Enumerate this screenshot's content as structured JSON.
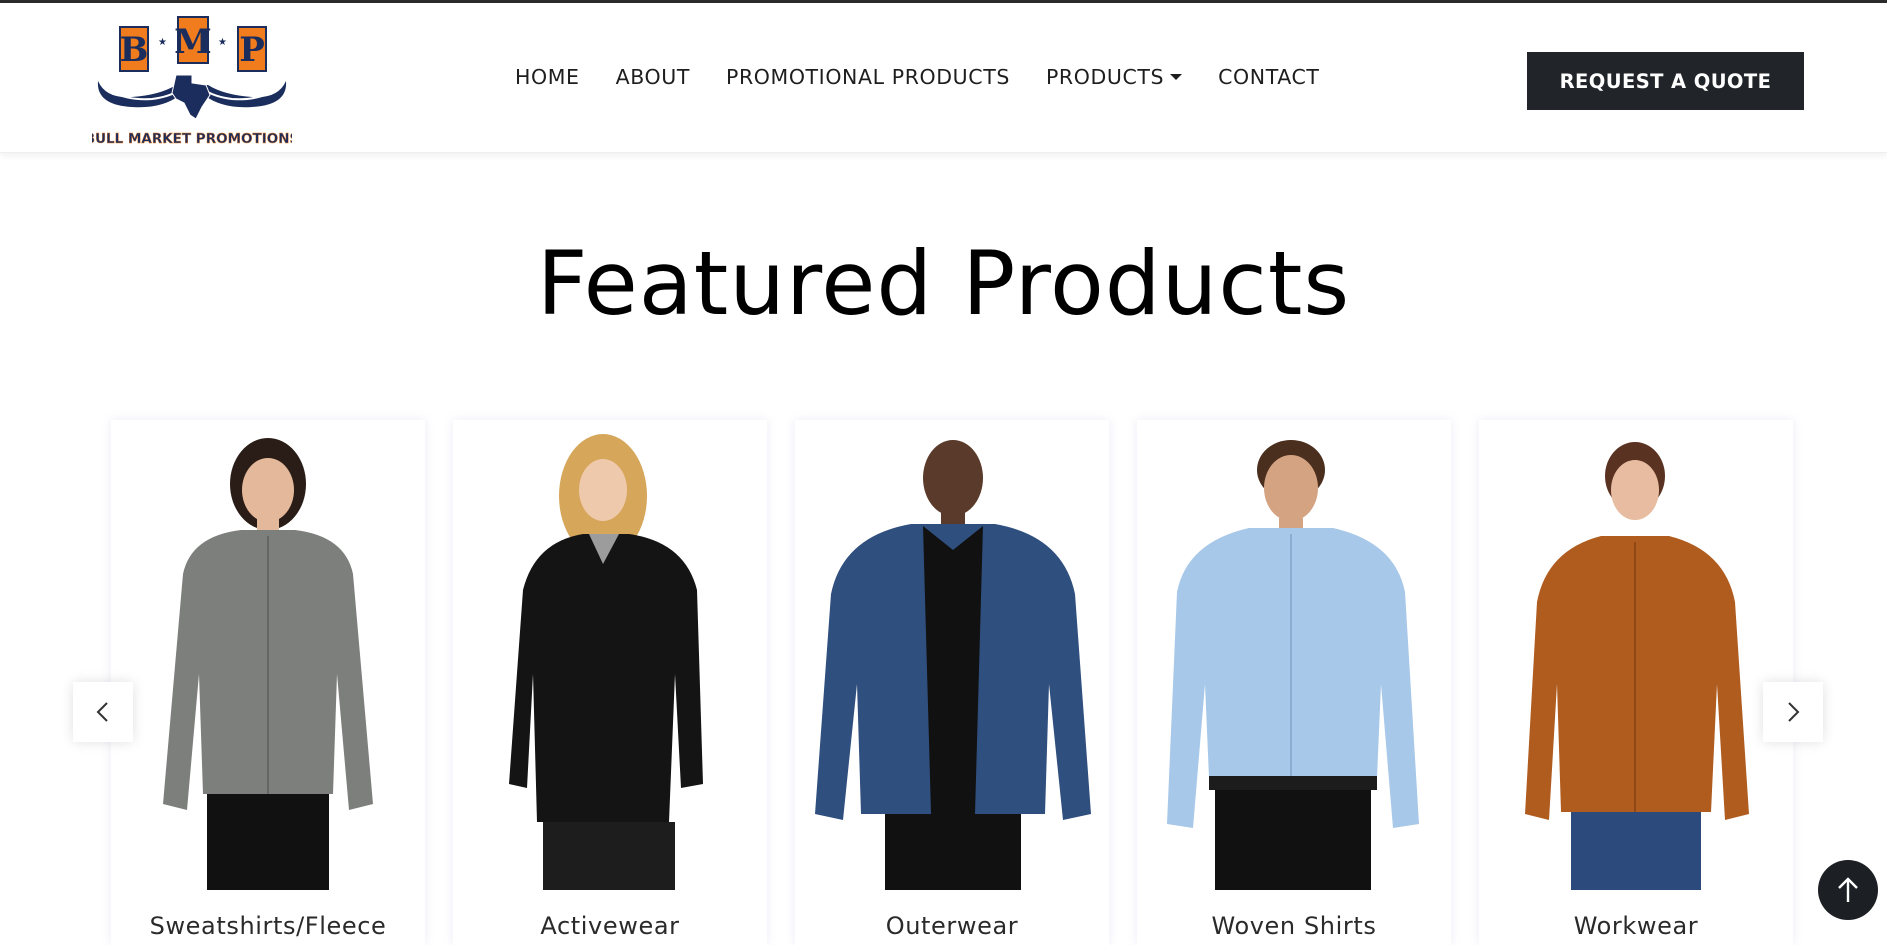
{
  "brand": {
    "logo_letters": [
      "B",
      "M",
      "P"
    ],
    "logo_text": "BULL MARKET PROMOTIONS",
    "colors": {
      "orange": "#f07c1e",
      "navy": "#1b2d5c"
    }
  },
  "nav": {
    "items": [
      {
        "label": "HOME"
      },
      {
        "label": "ABOUT"
      },
      {
        "label": "PROMOTIONAL PRODUCTS"
      },
      {
        "label": "PRODUCTS",
        "has_dropdown": true
      },
      {
        "label": "CONTACT"
      }
    ],
    "cta_label": "REQUEST A QUOTE"
  },
  "featured": {
    "title": "Featured Products",
    "products": [
      {
        "name": "Sweatshirts/Fleece",
        "garment_color": "#7d7f7c"
      },
      {
        "name": "Activewear",
        "garment_color": "#141414"
      },
      {
        "name": "Outerwear",
        "garment_color": "#2f4f7f"
      },
      {
        "name": "Woven Shirts",
        "garment_color": "#a7c8e8"
      },
      {
        "name": "Workwear",
        "garment_color": "#b05c1f"
      }
    ]
  },
  "icons": {
    "prev": "chevron-left-icon",
    "next": "chevron-right-icon",
    "back_to_top": "arrow-up-icon"
  }
}
